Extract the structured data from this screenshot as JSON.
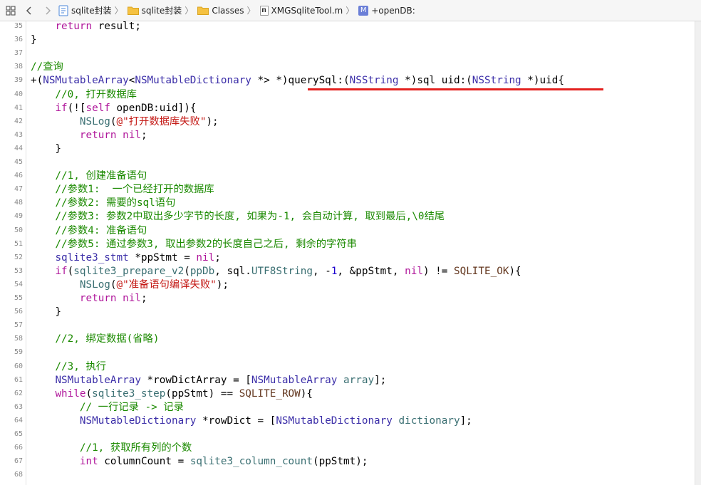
{
  "jumpbar": {
    "items": [
      {
        "label": "sqlite封装",
        "icon": "project-icon"
      },
      {
        "label": "sqlite封装",
        "icon": "folder-icon"
      },
      {
        "label": "Classes",
        "icon": "folder-icon"
      },
      {
        "label": "XMGSqliteTool.m",
        "icon": "m-file-icon"
      },
      {
        "label": "+openDB:",
        "icon": "method-icon"
      }
    ],
    "method_badge": "M",
    "mfile_badge": "m"
  },
  "lines": [
    {
      "n": "35",
      "segs": [
        [
          "",
          "    "
        ],
        [
          "kw",
          "return"
        ],
        [
          "",
          " result;"
        ]
      ]
    },
    {
      "n": "36",
      "segs": [
        [
          "",
          "}"
        ]
      ]
    },
    {
      "n": "37",
      "segs": []
    },
    {
      "n": "38",
      "segs": [
        [
          "cm",
          "//查询"
        ]
      ]
    },
    {
      "n": "39",
      "segs": [
        [
          "",
          "+("
        ],
        [
          "ty",
          "NSMutableArray"
        ],
        [
          "",
          "<"
        ],
        [
          "ty",
          "NSMutableDictionary"
        ],
        [
          "",
          " *> *)querySql:("
        ],
        [
          "ty",
          "NSString"
        ],
        [
          "",
          " *)sql uid:("
        ],
        [
          "ty",
          "NSString"
        ],
        [
          "",
          " *)uid{"
        ]
      ]
    },
    {
      "n": "40",
      "segs": [
        [
          "cm",
          "    //0, 打开数据库"
        ]
      ]
    },
    {
      "n": "41",
      "segs": [
        [
          "",
          "    "
        ],
        [
          "kw",
          "if"
        ],
        [
          "",
          "(!["
        ],
        [
          "kw",
          "self"
        ],
        [
          "",
          " openDB:uid]){"
        ]
      ]
    },
    {
      "n": "42",
      "segs": [
        [
          "",
          "        "
        ],
        [
          "fn",
          "NSLog"
        ],
        [
          "",
          "("
        ],
        [
          "st",
          "@\"打开数据库失败\""
        ],
        [
          "",
          ");"
        ]
      ]
    },
    {
      "n": "43",
      "segs": [
        [
          "",
          "        "
        ],
        [
          "kw",
          "return"
        ],
        [
          "",
          " "
        ],
        [
          "kw",
          "nil"
        ],
        [
          "",
          ";"
        ]
      ]
    },
    {
      "n": "44",
      "segs": [
        [
          "",
          "    }"
        ]
      ]
    },
    {
      "n": "45",
      "segs": []
    },
    {
      "n": "46",
      "segs": [
        [
          "cm",
          "    //1, 创建准备语句"
        ]
      ]
    },
    {
      "n": "47",
      "segs": [
        [
          "cm",
          "    //参数1:  一个已经打开的数据库"
        ]
      ]
    },
    {
      "n": "48",
      "segs": [
        [
          "cm",
          "    //参数2: 需要的sql语句"
        ]
      ]
    },
    {
      "n": "49",
      "segs": [
        [
          "cm",
          "    //参数3: 参数2中取出多少字节的长度, 如果为-1, 会自动计算, 取到最后,\\0结尾"
        ]
      ]
    },
    {
      "n": "50",
      "segs": [
        [
          "cm",
          "    //参数4: 准备语句"
        ]
      ]
    },
    {
      "n": "51",
      "segs": [
        [
          "cm",
          "    //参数5: 通过参数3, 取出参数2的长度自己之后, 剩余的字符串"
        ]
      ]
    },
    {
      "n": "52",
      "segs": [
        [
          "",
          "    "
        ],
        [
          "ty",
          "sqlite3_stmt"
        ],
        [
          "",
          " *ppStmt = "
        ],
        [
          "kw",
          "nil"
        ],
        [
          "",
          ";"
        ]
      ]
    },
    {
      "n": "53",
      "segs": [
        [
          "",
          "    "
        ],
        [
          "kw",
          "if"
        ],
        [
          "",
          "("
        ],
        [
          "fn",
          "sqlite3_prepare_v2"
        ],
        [
          "",
          "("
        ],
        [
          "fn",
          "ppDb"
        ],
        [
          "",
          ", sql."
        ],
        [
          "fn",
          "UTF8String"
        ],
        [
          "",
          ", -"
        ],
        [
          "nu",
          "1"
        ],
        [
          "",
          ", &ppStmt, "
        ],
        [
          "kw",
          "nil"
        ],
        [
          "",
          ") != "
        ],
        [
          "mc",
          "SQLITE_OK"
        ],
        [
          "",
          "){"
        ]
      ]
    },
    {
      "n": "54",
      "segs": [
        [
          "",
          "        "
        ],
        [
          "fn",
          "NSLog"
        ],
        [
          "",
          "("
        ],
        [
          "st",
          "@\"准备语句编译失败\""
        ],
        [
          "",
          ");"
        ]
      ]
    },
    {
      "n": "55",
      "segs": [
        [
          "",
          "        "
        ],
        [
          "kw",
          "return"
        ],
        [
          "",
          " "
        ],
        [
          "kw",
          "nil"
        ],
        [
          "",
          ";"
        ]
      ]
    },
    {
      "n": "56",
      "segs": [
        [
          "",
          "    }"
        ]
      ]
    },
    {
      "n": "57",
      "segs": []
    },
    {
      "n": "58",
      "segs": [
        [
          "cm",
          "    //2, 绑定数据(省略)"
        ]
      ]
    },
    {
      "n": "59",
      "segs": []
    },
    {
      "n": "60",
      "segs": [
        [
          "cm",
          "    //3, 执行"
        ]
      ]
    },
    {
      "n": "61",
      "segs": [
        [
          "",
          "    "
        ],
        [
          "ty",
          "NSMutableArray"
        ],
        [
          "",
          " *rowDictArray = ["
        ],
        [
          "ty",
          "NSMutableArray"
        ],
        [
          "",
          " "
        ],
        [
          "fn",
          "array"
        ],
        [
          "",
          "];"
        ]
      ]
    },
    {
      "n": "62",
      "segs": [
        [
          "",
          "    "
        ],
        [
          "kw",
          "while"
        ],
        [
          "",
          "("
        ],
        [
          "fn",
          "sqlite3_step"
        ],
        [
          "",
          "(ppStmt) == "
        ],
        [
          "mc",
          "SQLITE_ROW"
        ],
        [
          "",
          "){"
        ]
      ]
    },
    {
      "n": "63",
      "segs": [
        [
          "cm",
          "        // 一行记录 -> 记录"
        ]
      ]
    },
    {
      "n": "64",
      "segs": [
        [
          "",
          "        "
        ],
        [
          "ty",
          "NSMutableDictionary"
        ],
        [
          "",
          " *rowDict = ["
        ],
        [
          "ty",
          "NSMutableDictionary"
        ],
        [
          "",
          " "
        ],
        [
          "fn",
          "dictionary"
        ],
        [
          "",
          "];"
        ]
      ]
    },
    {
      "n": "65",
      "segs": []
    },
    {
      "n": "66",
      "segs": [
        [
          "cm",
          "        //1, 获取所有列的个数"
        ]
      ]
    },
    {
      "n": "67",
      "segs": [
        [
          "",
          "        "
        ],
        [
          "kw",
          "int"
        ],
        [
          "",
          " columnCount = "
        ],
        [
          "fn",
          "sqlite3_column_count"
        ],
        [
          "",
          "(ppStmt);"
        ]
      ]
    },
    {
      "n": "68",
      "segs": []
    }
  ],
  "colors": {
    "keyword": "#b0179b",
    "type": "#3b2ea8",
    "comment": "#1b8a00",
    "string": "#c41a16",
    "function": "#3a6f72",
    "macro": "#643820",
    "number": "#1c00cf",
    "underline": "#e3211f"
  }
}
